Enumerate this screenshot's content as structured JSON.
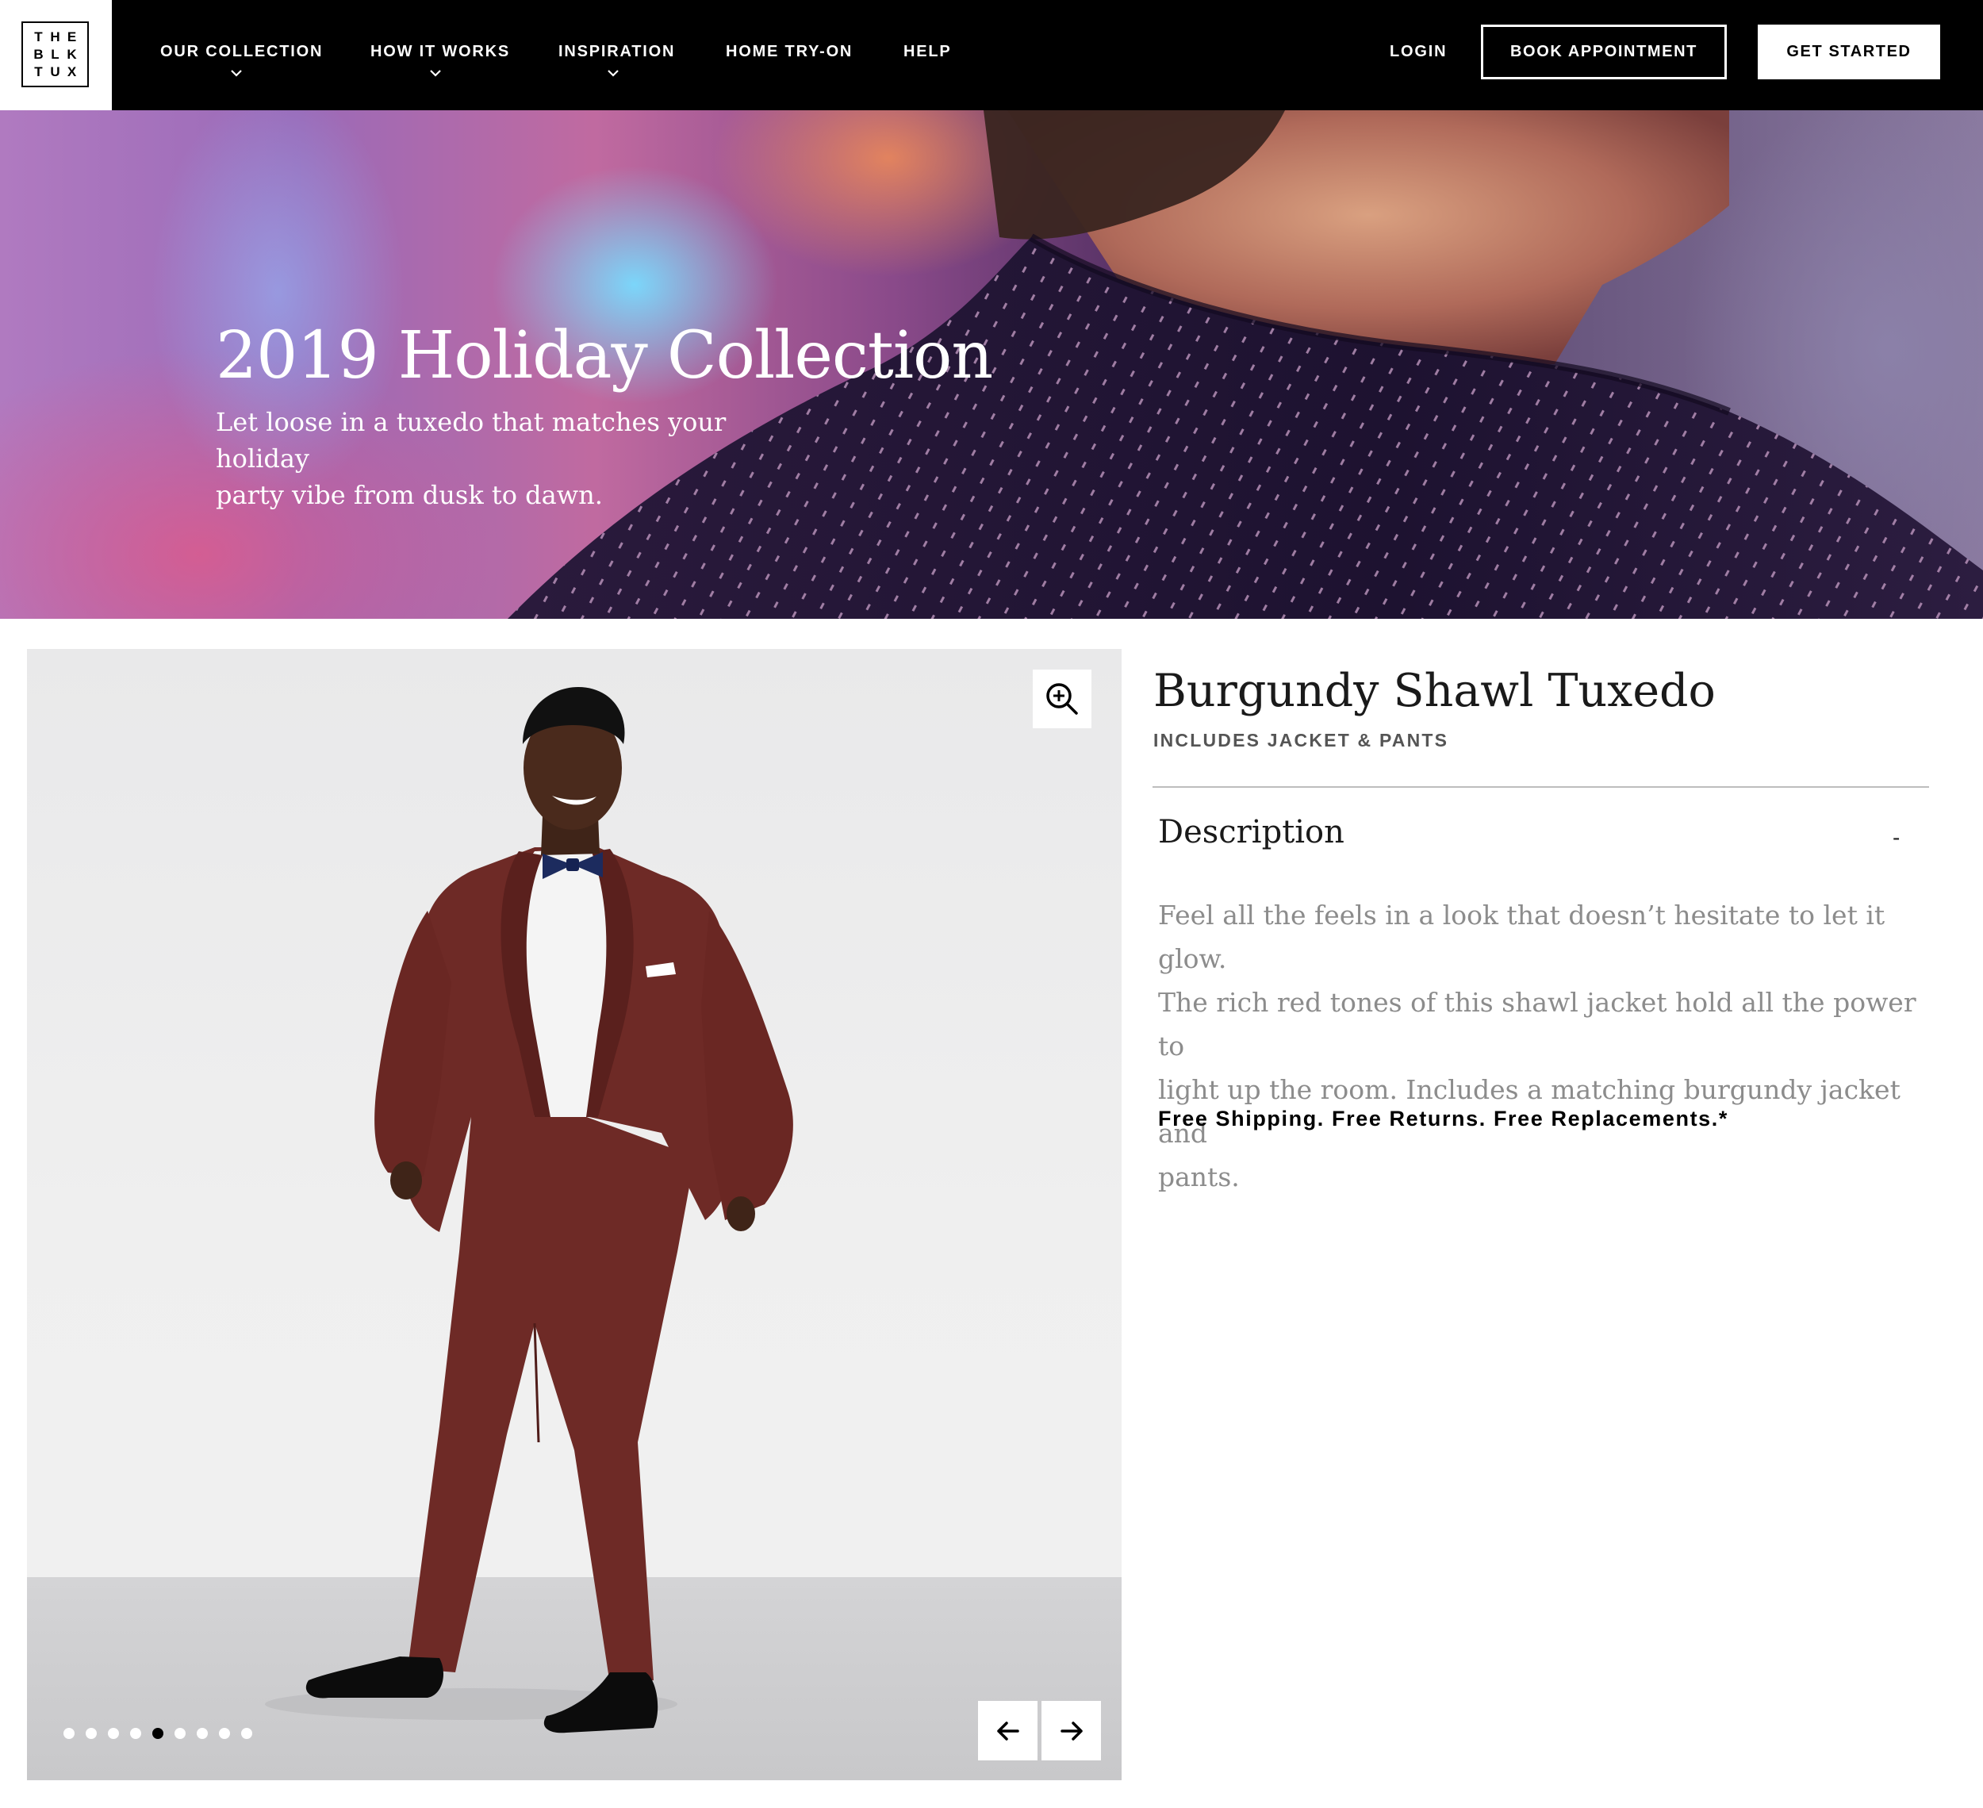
{
  "brand": {
    "logo_letters": [
      "T",
      "H",
      "E",
      "B",
      "L",
      "K",
      "T",
      "U",
      "X"
    ]
  },
  "nav": {
    "items": [
      {
        "label": "OUR COLLECTION",
        "has_dropdown": true
      },
      {
        "label": "HOW IT WORKS",
        "has_dropdown": true
      },
      {
        "label": "INSPIRATION",
        "has_dropdown": true
      },
      {
        "label": "HOME TRY-ON",
        "has_dropdown": false
      },
      {
        "label": "HELP",
        "has_dropdown": false
      }
    ],
    "login_label": "LOGIN",
    "book_label": "BOOK APPOINTMENT",
    "started_label": "GET STARTED"
  },
  "hero": {
    "title": "2019 Holiday Collection",
    "subtitle_line1": "Let loose in a tuxedo that matches your holiday",
    "subtitle_line2": "party vibe from dusk to dawn."
  },
  "gallery": {
    "dot_count": 9,
    "active_dot": 5,
    "zoom_icon": "zoom-in-icon",
    "prev_icon": "arrow-left-icon",
    "next_icon": "arrow-right-icon"
  },
  "product": {
    "title": "Burgundy Shawl Tuxedo",
    "subtitle": "INCLUDES JACKET & PANTS",
    "description_heading": "Description",
    "description_toggle": "-",
    "description_line1": "Feel all the feels in a look that doesn’t hesitate to let it glow.",
    "description_line2": "The rich red tones of this shawl jacket hold all the power to",
    "description_line3": "light up the room. Includes a matching burgundy jacket and",
    "description_line4": "pants.",
    "shipping": "Free Shipping. Free Returns. Free Replacements.*"
  },
  "colors": {
    "nav_bg": "#000000",
    "suit": "#6e2a26",
    "tie": "#1c2b5e",
    "text_muted": "#8c8c8c"
  }
}
